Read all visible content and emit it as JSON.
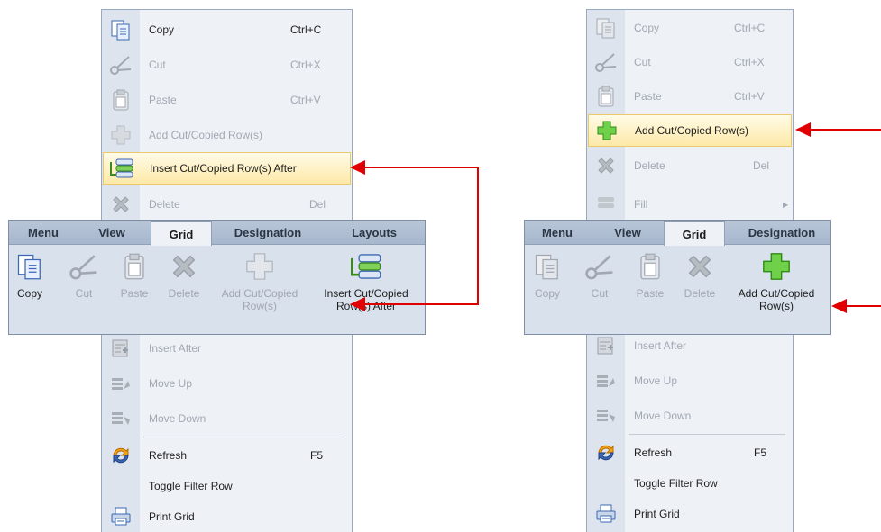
{
  "left": {
    "menu_items": [
      {
        "label": "Copy",
        "shortcut": "Ctrl+C",
        "icon": "copy-icon",
        "enabled": true
      },
      {
        "label": "Cut",
        "shortcut": "Ctrl+X",
        "icon": "scissors-icon",
        "enabled": false
      },
      {
        "label": "Paste",
        "shortcut": "Ctrl+V",
        "icon": "paste-icon",
        "enabled": false
      },
      {
        "label": "Add Cut/Copied Row(s)",
        "shortcut": "",
        "icon": "plus-icon",
        "enabled": false
      },
      {
        "label": "Insert Cut/Copied Row(s) After",
        "shortcut": "",
        "icon": "insert-rows-after-icon",
        "enabled": true,
        "highlighted": true
      },
      {
        "label": "Delete",
        "shortcut": "Del",
        "icon": "delete-x-icon",
        "enabled": false
      },
      {
        "label": "Insert After",
        "shortcut": "",
        "icon": "insert-after-icon",
        "enabled": false
      },
      {
        "label": "Move Up",
        "shortcut": "",
        "icon": "move-up-icon",
        "enabled": false
      },
      {
        "label": "Move Down",
        "shortcut": "",
        "icon": "move-down-icon",
        "enabled": false
      },
      {
        "label": "Refresh",
        "shortcut": "F5",
        "icon": "refresh-icon",
        "enabled": true
      },
      {
        "label": "Toggle Filter Row",
        "shortcut": "",
        "icon": "",
        "enabled": true
      },
      {
        "label": "Print Grid",
        "shortcut": "",
        "icon": "printer-icon",
        "enabled": true
      }
    ],
    "ribbon": {
      "tabs": [
        "Menu",
        "View",
        "Grid",
        "Designation",
        "Layouts"
      ],
      "active_tab": "Grid",
      "buttons": [
        {
          "label": "Copy",
          "enabled": true,
          "icon": "copy-icon"
        },
        {
          "label": "Cut",
          "enabled": false,
          "icon": "scissors-icon"
        },
        {
          "label": "Paste",
          "enabled": false,
          "icon": "paste-icon"
        },
        {
          "label": "Delete",
          "enabled": false,
          "icon": "delete-x-icon"
        },
        {
          "label": "Add Cut/Copied Row(s)",
          "enabled": false,
          "icon": "plus-icon"
        },
        {
          "label": "Insert Cut/Copied Row(s) After",
          "enabled": true,
          "icon": "insert-rows-after-icon"
        }
      ]
    }
  },
  "right": {
    "menu_items": [
      {
        "label": "Copy",
        "shortcut": "Ctrl+C",
        "icon": "copy-icon",
        "enabled": false
      },
      {
        "label": "Cut",
        "shortcut": "Ctrl+X",
        "icon": "scissors-icon",
        "enabled": false
      },
      {
        "label": "Paste",
        "shortcut": "Ctrl+V",
        "icon": "paste-icon",
        "enabled": false
      },
      {
        "label": "Add Cut/Copied Row(s)",
        "shortcut": "",
        "icon": "plus-icon",
        "enabled": true,
        "highlighted": true
      },
      {
        "label": "Delete",
        "shortcut": "Del",
        "icon": "delete-x-icon",
        "enabled": false
      },
      {
        "label": "Fill",
        "shortcut": "",
        "icon": "fill-icon",
        "enabled": false,
        "submenu": true
      },
      {
        "label": "Insert After",
        "shortcut": "",
        "icon": "insert-after-icon",
        "enabled": false
      },
      {
        "label": "Move Up",
        "shortcut": "",
        "icon": "move-up-icon",
        "enabled": false
      },
      {
        "label": "Move Down",
        "shortcut": "",
        "icon": "move-down-icon",
        "enabled": false
      },
      {
        "label": "Refresh",
        "shortcut": "F5",
        "icon": "refresh-icon",
        "enabled": true
      },
      {
        "label": "Toggle Filter Row",
        "shortcut": "",
        "icon": "",
        "enabled": true
      },
      {
        "label": "Print Grid",
        "shortcut": "",
        "icon": "printer-icon",
        "enabled": true
      }
    ],
    "ribbon": {
      "tabs": [
        "Menu",
        "View",
        "Grid",
        "Designation"
      ],
      "active_tab": "Grid",
      "buttons": [
        {
          "label": "Copy",
          "enabled": false,
          "icon": "copy-icon"
        },
        {
          "label": "Cut",
          "enabled": false,
          "icon": "scissors-icon"
        },
        {
          "label": "Paste",
          "enabled": false,
          "icon": "paste-icon"
        },
        {
          "label": "Delete",
          "enabled": false,
          "icon": "delete-x-icon"
        },
        {
          "label": "Add Cut/Copied Row(s)",
          "enabled": true,
          "icon": "plus-icon"
        }
      ]
    }
  },
  "colors": {
    "arrow": "#e00000",
    "highlight": "#fde9a8",
    "disabled_text": "#a2a8b2",
    "icon_green": "#5cc02e",
    "icon_blue": "#3b67b5"
  }
}
